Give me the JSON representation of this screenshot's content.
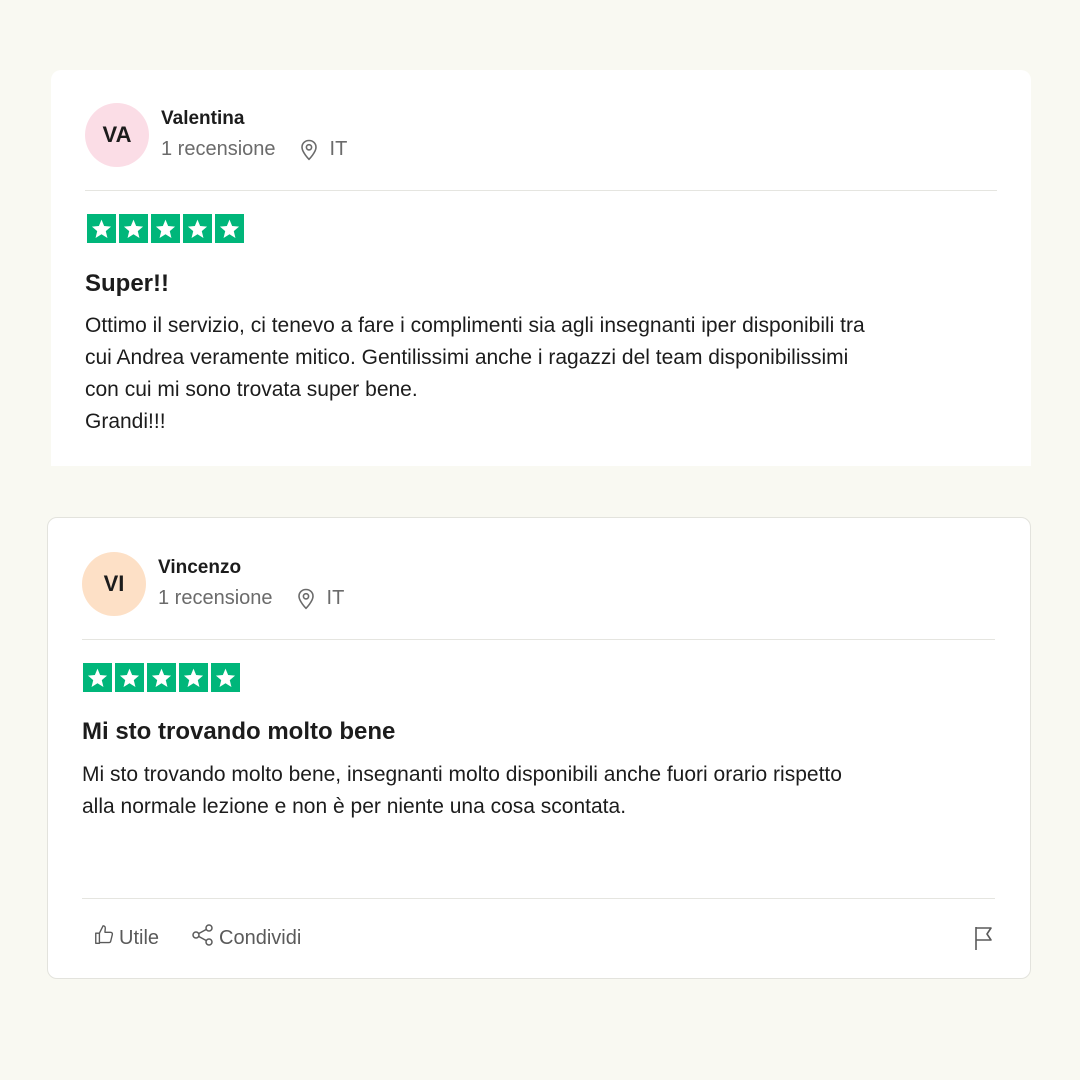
{
  "reviews": [
    {
      "initials": "VA",
      "avatar_color": "#fbdde6",
      "name": "Valentina",
      "review_count": "1 recensione",
      "country": "IT",
      "rating": 5,
      "title": "Super!!",
      "body": "Ottimo il servizio, ci tenevo a fare i complimenti sia agli insegnanti iper disponibili tra\ncui Andrea veramente mitico. Gentilissimi anche i ragazzi del team disponibilissimi\ncon cui mi sono trovata super bene.\nGrandi!!!"
    },
    {
      "initials": "VI",
      "avatar_color": "#fde0c6",
      "name": "Vincenzo",
      "review_count": "1 recensione",
      "country": "IT",
      "rating": 5,
      "title": "Mi sto trovando molto bene",
      "body": "Mi sto trovando molto bene, insegnanti molto disponibili anche fuori orario rispetto\nalla normale lezione e non è per niente una cosa scontata.",
      "actions": {
        "useful_label": "Utile",
        "share_label": "Condividi"
      }
    }
  ],
  "colors": {
    "star_green": "#00b67a",
    "background": "#f9f9f2"
  }
}
